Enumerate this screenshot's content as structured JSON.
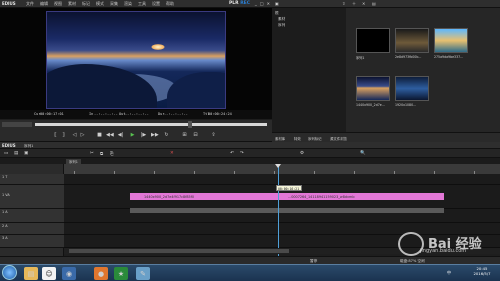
{
  "app": {
    "logo": "EDIUS",
    "menu": [
      "文件",
      "编辑",
      "视图",
      "素材",
      "标记",
      "模式",
      "采集",
      "渲染",
      "工具",
      "设置",
      "帮助"
    ],
    "mode_label": "PLR",
    "mode_rec": "REC",
    "win_controls": [
      "_",
      "□",
      "✕"
    ]
  },
  "preview": {
    "tc_cur_label": "Cur",
    "tc_cur": "00:00:17:01",
    "tc_in_label": "In",
    "tc_in": "--:--:--:--",
    "tc_out_label": "Out",
    "tc_out": "--:--:--:--",
    "tc_dur_label": "Dur",
    "tc_dur": "--:--:--:--",
    "tc_ttl_label": "Ttl",
    "tc_ttl": "00:00:24:24"
  },
  "transport_icons": [
    "mark-in",
    "mark-out",
    "set-in",
    "set-out",
    "stop",
    "rewind",
    "step-back",
    "play",
    "step-forward",
    "fast-forward",
    "loop",
    "insert",
    "overwrite",
    "export"
  ],
  "bin": {
    "tree": [
      "根",
      "素材",
      "序列"
    ],
    "items": [
      {
        "label": "序列1"
      },
      {
        "label": "2e8d973fb00b..."
      },
      {
        "label": "275a9da9be337..."
      },
      {
        "label": "1440x900_2d7e..."
      },
      {
        "label": "1920x1080..."
      }
    ],
    "tabs": [
      "素材库",
      "特效",
      "序列标记",
      "源文件浏览"
    ]
  },
  "timeline": {
    "title": "EDIUS",
    "seq_title": "序列1",
    "seq_tab": "序列1",
    "tracks": [
      {
        "name": "1 T",
        "type": "title"
      },
      {
        "name": "1 VA",
        "type": "video"
      },
      {
        "name": "1 A",
        "type": "audio"
      },
      {
        "name": "2 A",
        "type": "audio"
      },
      {
        "name": "3 A",
        "type": "audio"
      }
    ],
    "clip_label_1": "1440x900_2d7e4f917c8f85f0",
    "clip_label_2": "...0007264_14118941159023_w8dvmb",
    "playhead_tc": "00:00:16:21",
    "status_left": "暂停",
    "status_right": "磁盘:87% 空闲"
  },
  "taskbar": {
    "apps": [
      "explorer",
      "qq",
      "firefox",
      "media",
      "tools"
    ],
    "time": "20:45",
    "date": "2016/5/7",
    "ime": "中"
  },
  "watermark": {
    "brand": "Bai 经验",
    "url": "jingyan.baidu.com"
  }
}
